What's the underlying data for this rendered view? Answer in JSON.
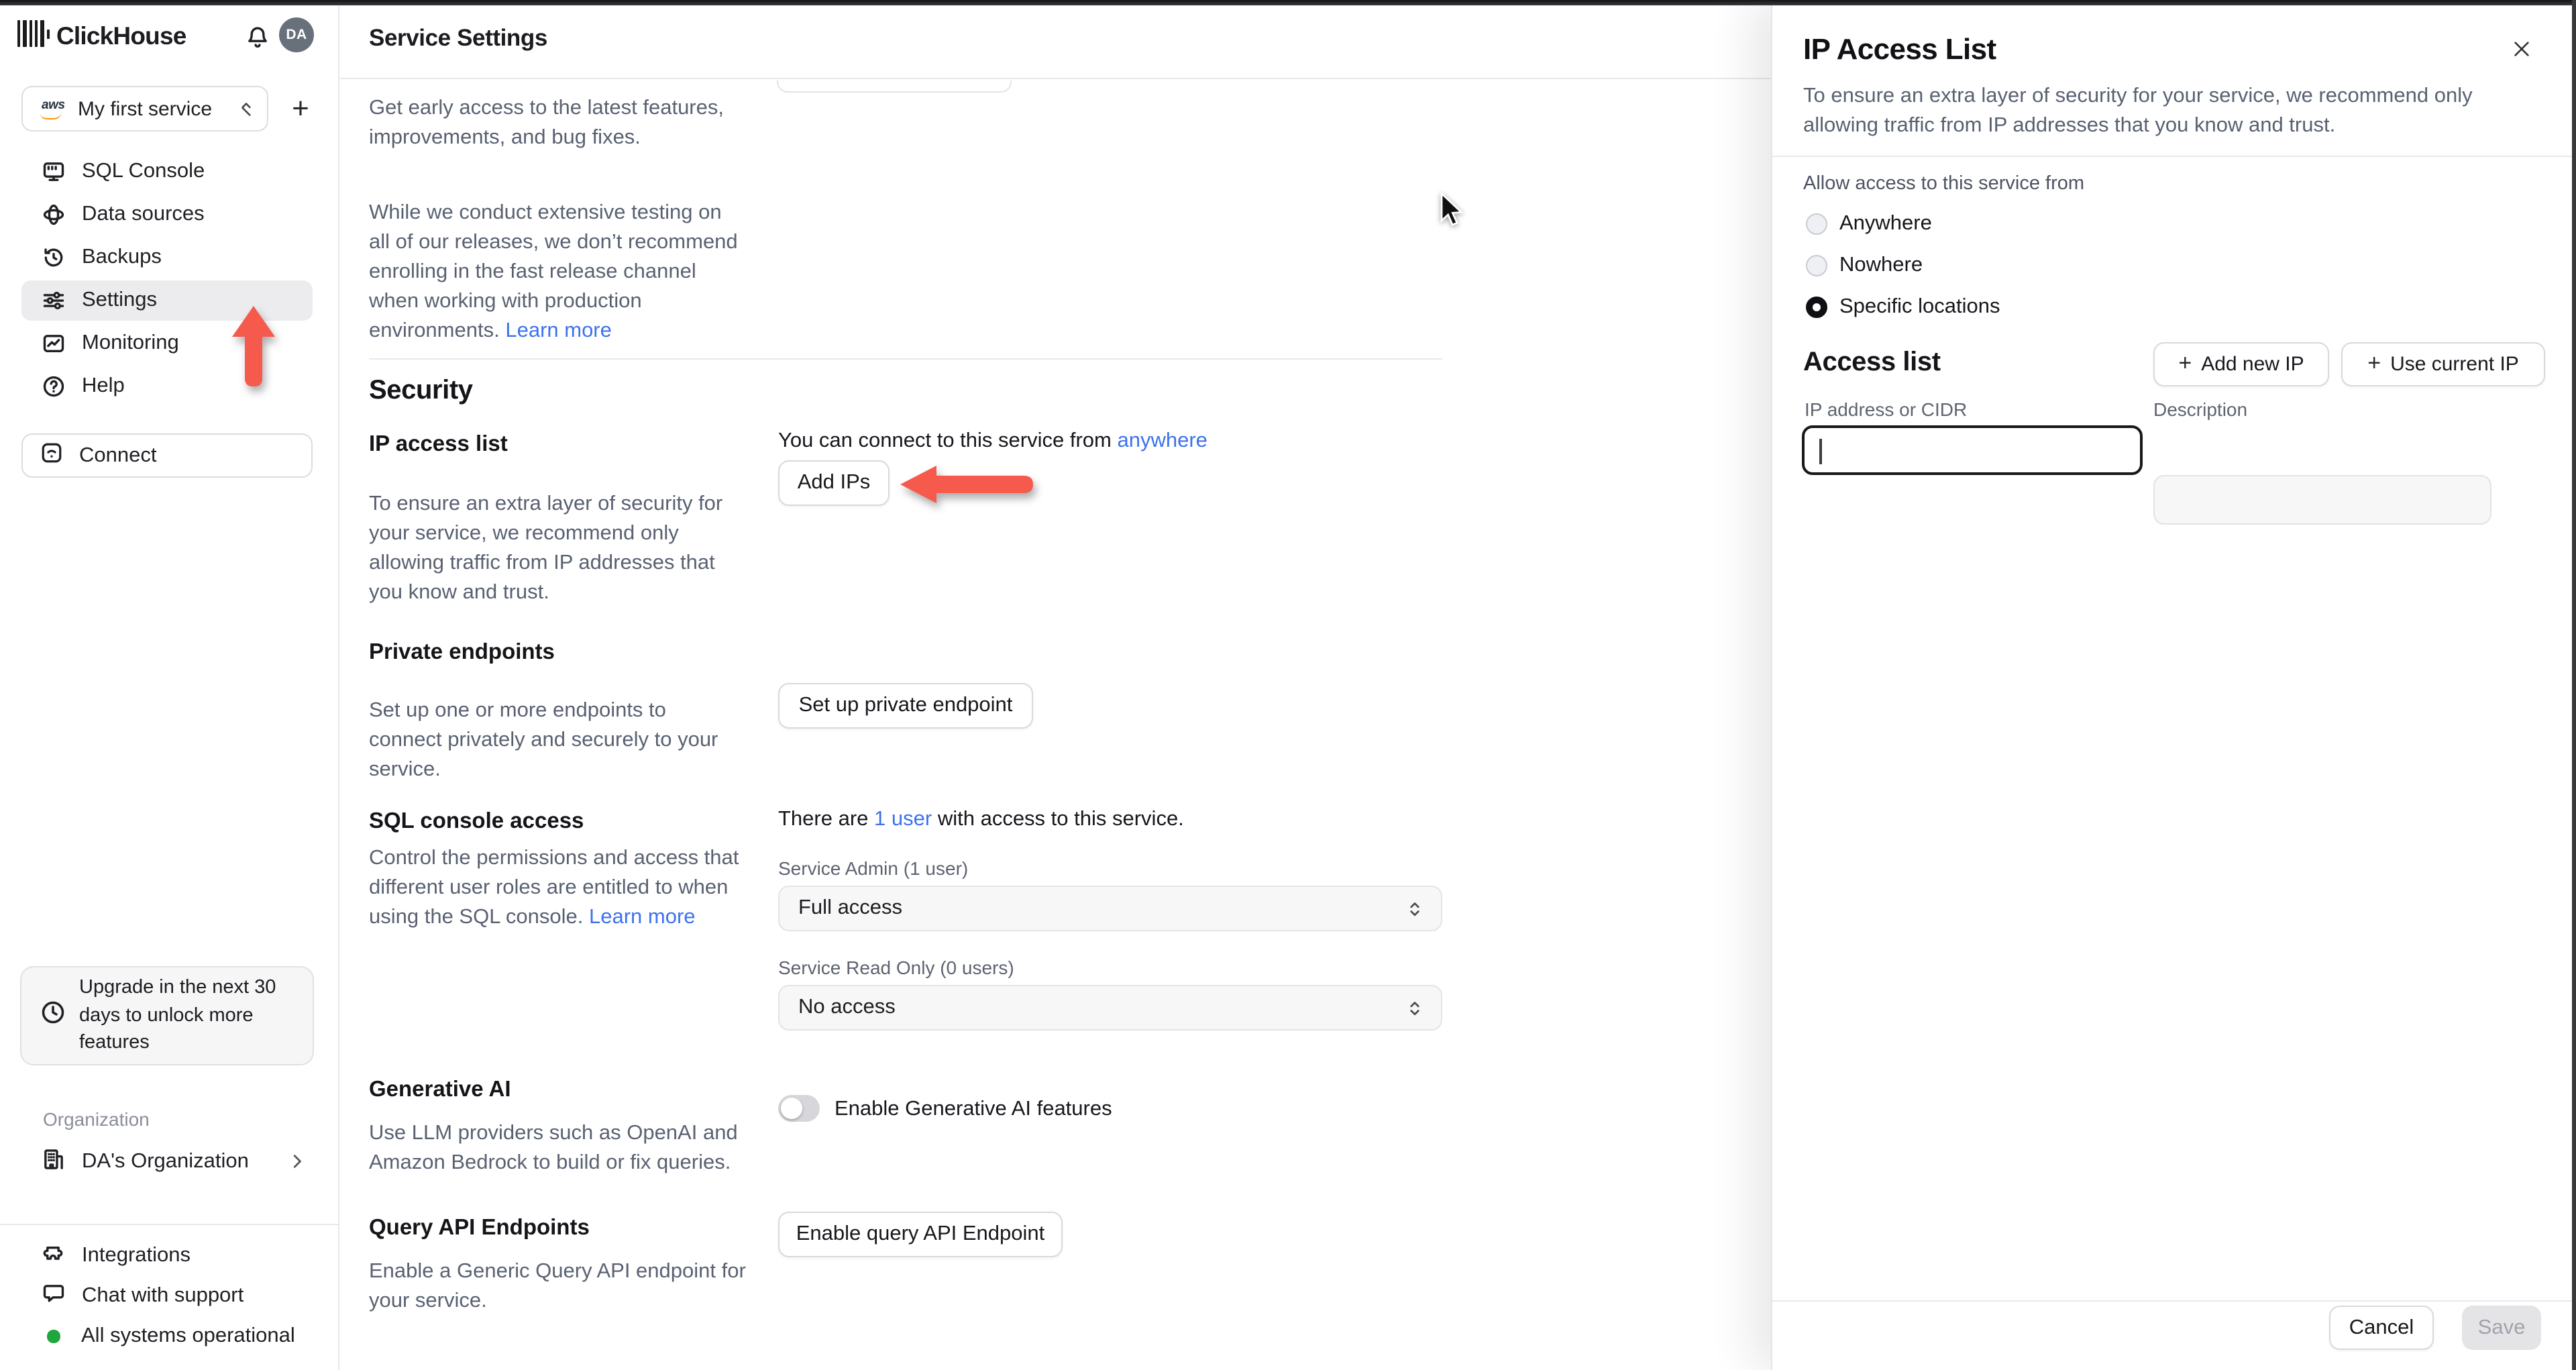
{
  "colors": {
    "accent_blue": "#3c72ee",
    "annotation_red": "#f65a4d",
    "status_green": "#1fa63c",
    "active_nav_bg": "#ececee",
    "disabled_btn_bg": "#e4e4e7"
  },
  "sidebar": {
    "brand": "ClickHouse",
    "avatar_initials": "DA",
    "service_selector": {
      "provider": "aws",
      "label": "My first service"
    },
    "add_service_label": "+",
    "nav": [
      {
        "label": "SQL Console",
        "active": false
      },
      {
        "label": "Data sources",
        "active": false
      },
      {
        "label": "Backups",
        "active": false
      },
      {
        "label": "Settings",
        "active": true
      },
      {
        "label": "Monitoring",
        "active": false
      },
      {
        "label": "Help",
        "active": false
      }
    ],
    "connect_label": "Connect",
    "upgrade_notice": "Upgrade in the next 30 days to unlock more features",
    "organization_section_label": "Organization",
    "organization_name": "DA's Organization",
    "footer": {
      "integrations": "Integrations",
      "chat": "Chat with support",
      "status": "All systems operational"
    }
  },
  "header": {
    "title": "Service Settings"
  },
  "main": {
    "fast_release": {
      "para1": "Get early access to the latest features, improvements, and bug fixes.",
      "para2": "While we conduct extensive testing on all of our releases, we don’t recommend enrolling in the fast release channel when working with production environments. ",
      "learn_more": "Learn more"
    },
    "security": {
      "heading": "Security"
    },
    "ip_access_list": {
      "heading": "IP access list",
      "description": "To ensure an extra layer of security for your service, we recommend only allowing traffic from IP addresses that you know and trust.",
      "status_prefix": "You can connect to this service from ",
      "status_link": "anywhere",
      "add_ips_label": "Add IPs"
    },
    "private_endpoints": {
      "heading": "Private endpoints",
      "description": "Set up one or more endpoints to connect privately and securely to your service.",
      "button_label": "Set up private endpoint"
    },
    "sql_console_access": {
      "heading": "SQL console access",
      "status_prefix": "There are ",
      "status_link": "1 user",
      "status_suffix": " with access to this service.",
      "description": "Control the permissions and access that different user roles are entitled to when using the SQL console. ",
      "learn_more": "Learn more",
      "admin_label": "Service Admin (1 user)",
      "admin_value": "Full access",
      "readonly_label": "Service Read Only (0 users)",
      "readonly_value": "No access"
    },
    "generative_ai": {
      "heading": "Generative AI",
      "description": "Use LLM providers such as OpenAI and Amazon Bedrock to build or fix queries.",
      "toggle_label": "Enable Generative AI features",
      "toggle_on": false
    },
    "query_api": {
      "heading": "Query API Endpoints",
      "description": "Enable a Generic Query API endpoint for your service.",
      "button_label": "Enable query API Endpoint"
    }
  },
  "panel": {
    "title": "IP Access List",
    "close_glyph": "✕",
    "description": "To ensure an extra layer of security for your service, we recommend only allowing traffic from IP addresses that you know and trust.",
    "allow_label": "Allow access to this service from",
    "options": [
      {
        "label": "Anywhere",
        "selected": false
      },
      {
        "label": "Nowhere",
        "selected": false
      },
      {
        "label": "Specific locations",
        "selected": true
      }
    ],
    "access_list": {
      "heading": "Access list",
      "add_new_ip_label": "Add new IP",
      "use_current_ip_label": "Use current IP",
      "plus_glyph": "+",
      "ip_field_label": "IP address or CIDR",
      "desc_field_label": "Description",
      "ip_value": "",
      "desc_value": ""
    },
    "footer": {
      "cancel_label": "Cancel",
      "save_label": "Save"
    }
  }
}
